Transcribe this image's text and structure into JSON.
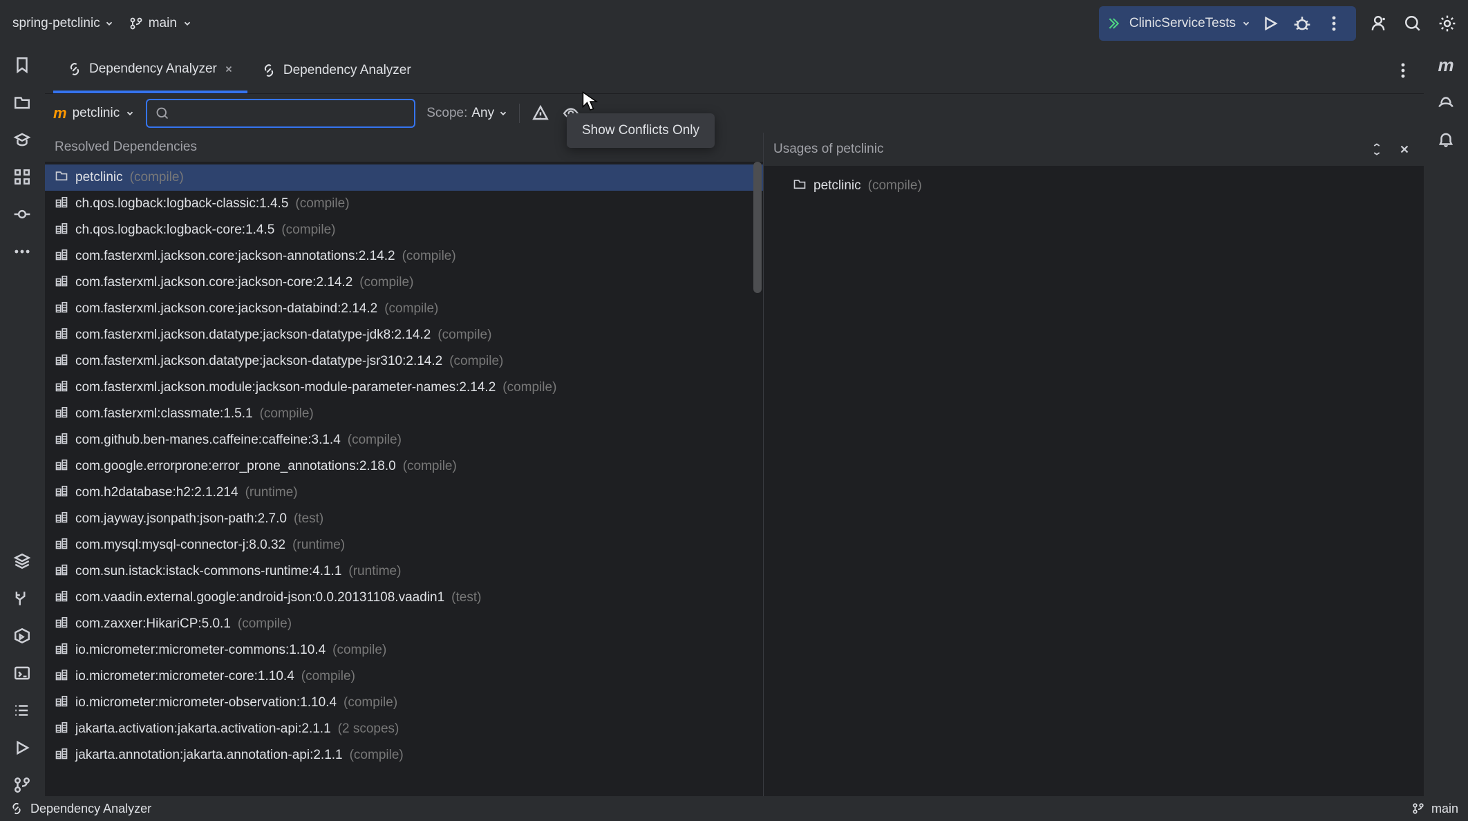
{
  "topbar": {
    "project_name": "spring-petclinic",
    "branch": "main",
    "run_config": "ClinicServiceTests"
  },
  "tabs": [
    {
      "label": "Dependency Analyzer",
      "closeable": true,
      "active": true
    },
    {
      "label": "Dependency Analyzer",
      "closeable": false,
      "active": false
    }
  ],
  "toolbar": {
    "module": "petclinic",
    "scope_label": "Scope:",
    "scope_value": "Any",
    "tooltip": "Show Conflicts Only"
  },
  "panels": {
    "left_title": "Resolved Dependencies",
    "right_title": "Usages of petclinic"
  },
  "dependencies": [
    {
      "name": "petclinic",
      "scope": "(compile)",
      "type": "folder",
      "selected": true
    },
    {
      "name": "ch.qos.logback:logback-classic:1.4.5",
      "scope": "(compile)",
      "type": "lib"
    },
    {
      "name": "ch.qos.logback:logback-core:1.4.5",
      "scope": "(compile)",
      "type": "lib"
    },
    {
      "name": "com.fasterxml.jackson.core:jackson-annotations:2.14.2",
      "scope": "(compile)",
      "type": "lib"
    },
    {
      "name": "com.fasterxml.jackson.core:jackson-core:2.14.2",
      "scope": "(compile)",
      "type": "lib"
    },
    {
      "name": "com.fasterxml.jackson.core:jackson-databind:2.14.2",
      "scope": "(compile)",
      "type": "lib"
    },
    {
      "name": "com.fasterxml.jackson.datatype:jackson-datatype-jdk8:2.14.2",
      "scope": "(compile)",
      "type": "lib"
    },
    {
      "name": "com.fasterxml.jackson.datatype:jackson-datatype-jsr310:2.14.2",
      "scope": "(compile)",
      "type": "lib"
    },
    {
      "name": "com.fasterxml.jackson.module:jackson-module-parameter-names:2.14.2",
      "scope": "(compile)",
      "type": "lib"
    },
    {
      "name": "com.fasterxml:classmate:1.5.1",
      "scope": "(compile)",
      "type": "lib"
    },
    {
      "name": "com.github.ben-manes.caffeine:caffeine:3.1.4",
      "scope": "(compile)",
      "type": "lib"
    },
    {
      "name": "com.google.errorprone:error_prone_annotations:2.18.0",
      "scope": "(compile)",
      "type": "lib"
    },
    {
      "name": "com.h2database:h2:2.1.214",
      "scope": "(runtime)",
      "type": "lib"
    },
    {
      "name": "com.jayway.jsonpath:json-path:2.7.0",
      "scope": "(test)",
      "type": "lib"
    },
    {
      "name": "com.mysql:mysql-connector-j:8.0.32",
      "scope": "(runtime)",
      "type": "lib"
    },
    {
      "name": "com.sun.istack:istack-commons-runtime:4.1.1",
      "scope": "(runtime)",
      "type": "lib"
    },
    {
      "name": "com.vaadin.external.google:android-json:0.0.20131108.vaadin1",
      "scope": "(test)",
      "type": "lib"
    },
    {
      "name": "com.zaxxer:HikariCP:5.0.1",
      "scope": "(compile)",
      "type": "lib"
    },
    {
      "name": "io.micrometer:micrometer-commons:1.10.4",
      "scope": "(compile)",
      "type": "lib"
    },
    {
      "name": "io.micrometer:micrometer-core:1.10.4",
      "scope": "(compile)",
      "type": "lib"
    },
    {
      "name": "io.micrometer:micrometer-observation:1.10.4",
      "scope": "(compile)",
      "type": "lib"
    },
    {
      "name": "jakarta.activation:jakarta.activation-api:2.1.1",
      "scope": "(2 scopes)",
      "type": "lib"
    },
    {
      "name": "jakarta.annotation:jakarta.annotation-api:2.1.1",
      "scope": "(compile)",
      "type": "lib"
    }
  ],
  "usages": [
    {
      "name": "petclinic",
      "scope": "(compile)",
      "type": "folder"
    }
  ],
  "statusbar": {
    "left_text": "Dependency Analyzer",
    "branch": "main"
  }
}
